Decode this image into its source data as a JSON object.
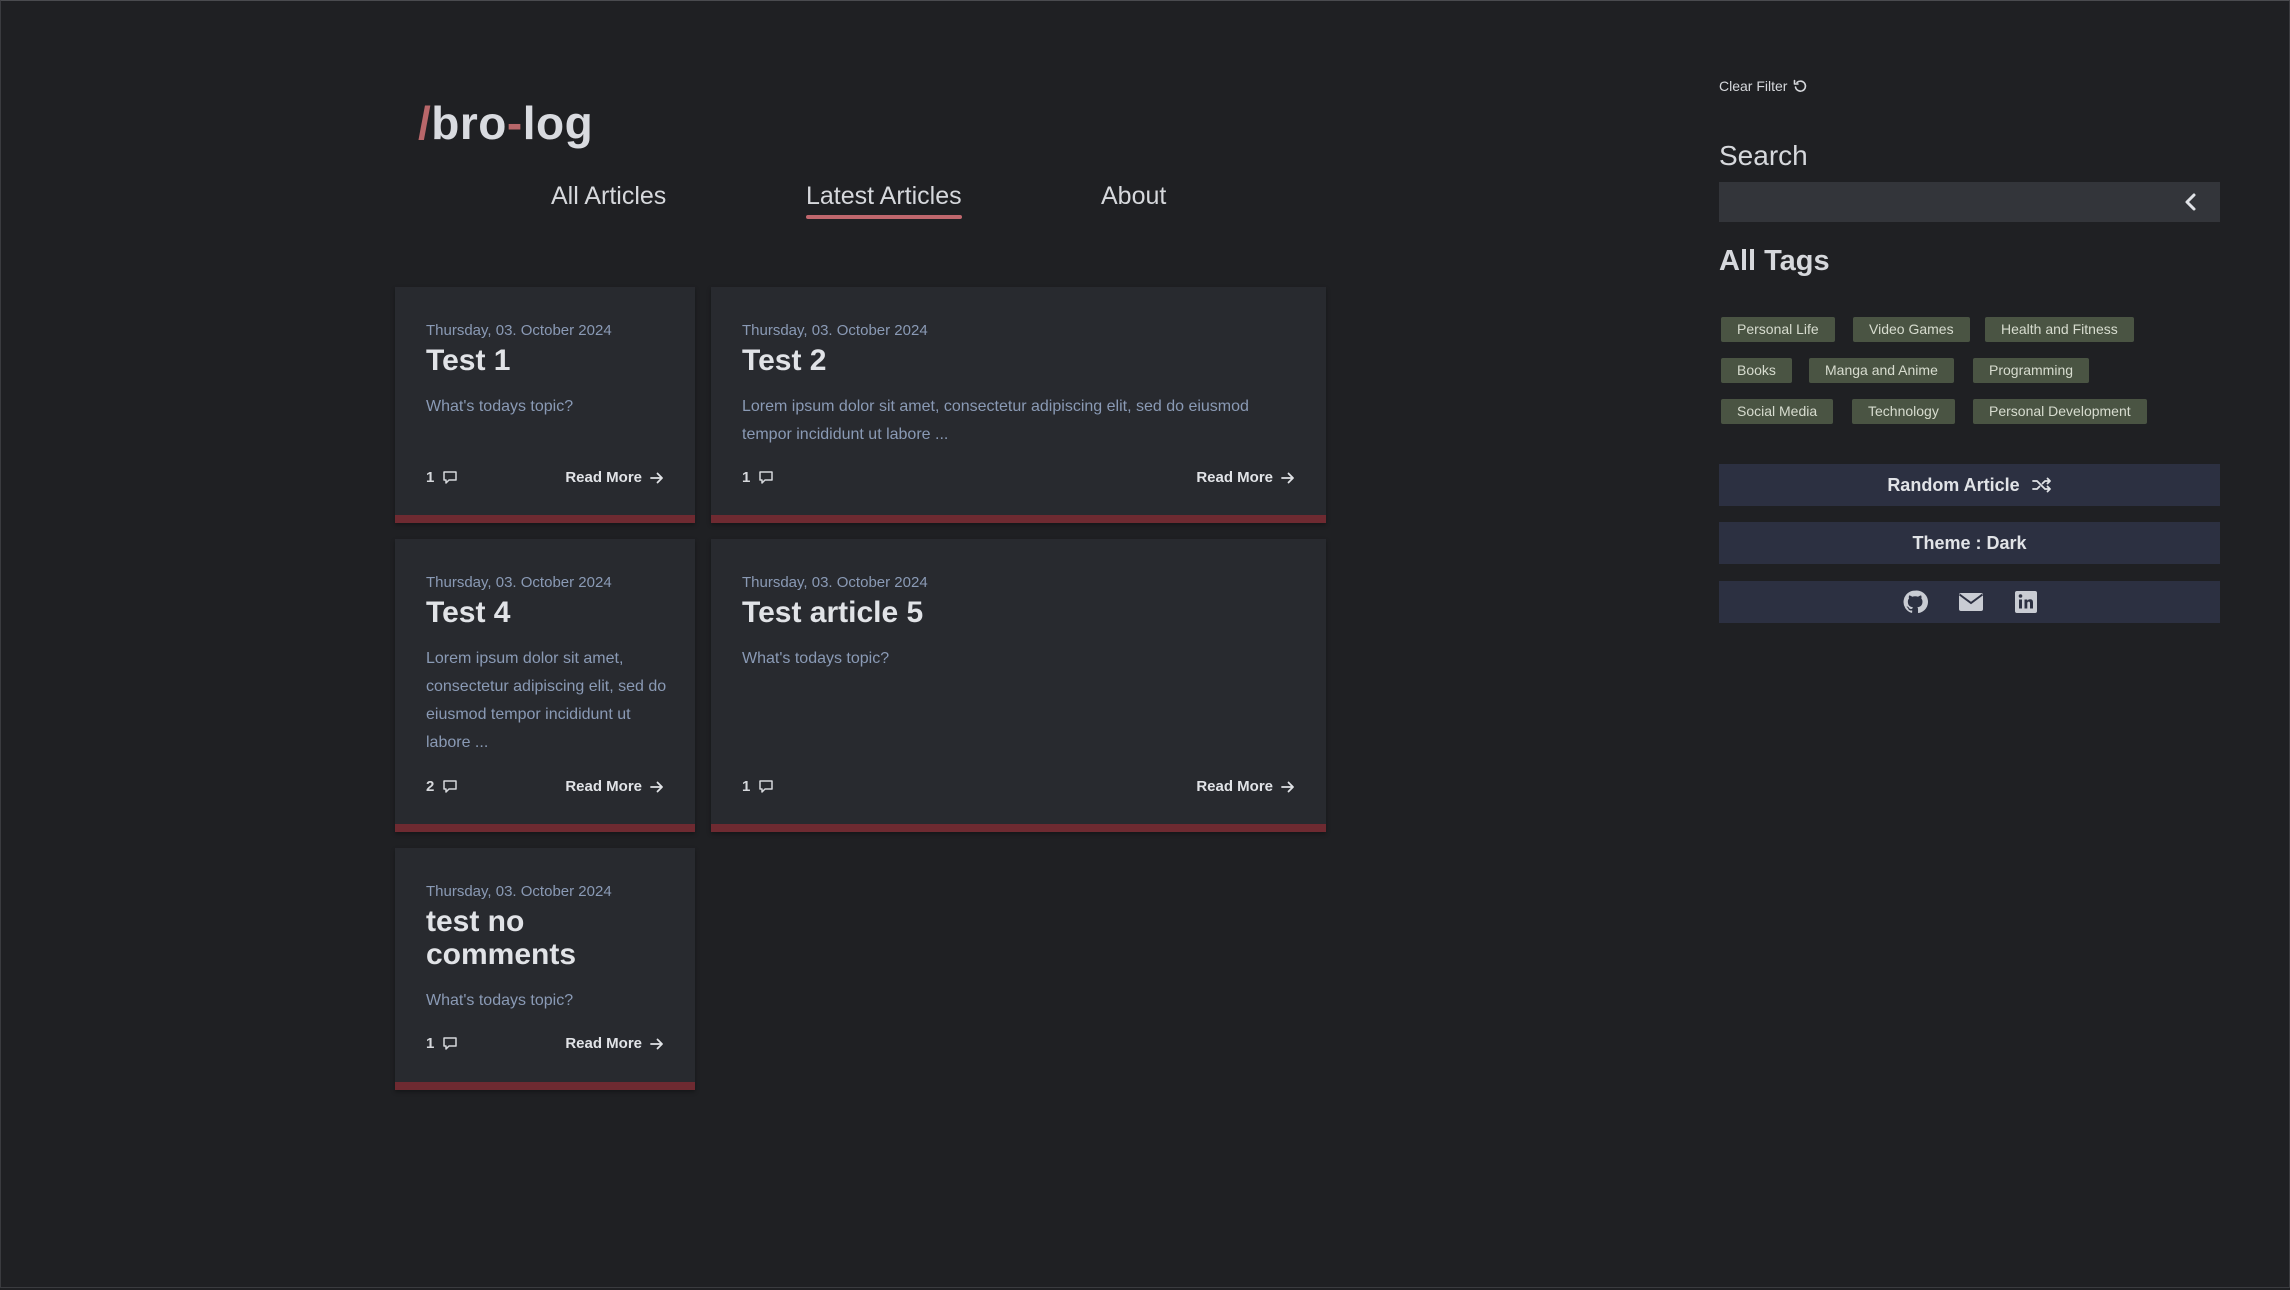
{
  "logo": {
    "slash": "/",
    "part1": "bro",
    "dash": "-",
    "part2": "log"
  },
  "nav": {
    "items": [
      "All Articles",
      "Latest Articles",
      "About"
    ],
    "active": "Latest Articles"
  },
  "articles": [
    {
      "date": "Thursday, 03. October 2024",
      "title": "Test 1",
      "excerpt": "What's todays topic?",
      "comments": "1",
      "read_more": "Read More"
    },
    {
      "date": "Thursday, 03. October 2024",
      "title": "Test 2",
      "excerpt": "Lorem ipsum dolor sit amet, consectetur adipiscing elit, sed do eiusmod tempor incididunt ut labore ...",
      "comments": "1",
      "read_more": "Read More"
    },
    {
      "date": "Thursday, 03. October 2024",
      "title": "Test 4",
      "excerpt": "Lorem ipsum dolor sit amet, consectetur adipiscing elit, sed do eiusmod tempor incididunt ut labore ...",
      "comments": "2",
      "read_more": "Read More"
    },
    {
      "date": "Thursday, 03. October 2024",
      "title": "Test article 5",
      "excerpt": "What's todays topic?",
      "comments": "1",
      "read_more": "Read More"
    },
    {
      "date": "Thursday, 03. October 2024",
      "title": "test no comments",
      "excerpt": "What's todays topic?",
      "comments": "1",
      "read_more": "Read More"
    }
  ],
  "sidebar": {
    "clear_filter": "Clear Filter",
    "search_heading": "Search",
    "search_value": "",
    "tags_heading": "All Tags",
    "tags": [
      "Personal Life",
      "Video Games",
      "Health and Fitness",
      "Books",
      "Manga and Anime",
      "Programming",
      "Social Media",
      "Technology",
      "Personal Development"
    ],
    "random_article": "Random Article",
    "theme": "Theme : Dark",
    "social_icons": [
      "github-icon",
      "mail-icon",
      "linkedin-icon"
    ]
  },
  "colors": {
    "background": "#1f2023",
    "card": "#282a2f",
    "card_accent": "#6e2a31",
    "tag": "#4a5443",
    "button": "#2c3041",
    "link_underline": "#c0676d"
  }
}
